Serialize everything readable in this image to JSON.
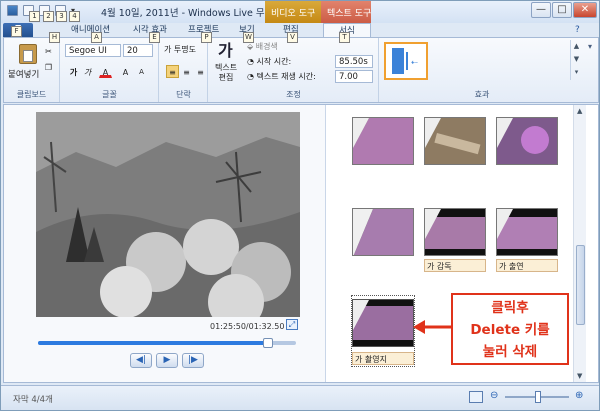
{
  "window": {
    "title": "4월 10일, 2011년 - Windows Live 무비 메이커",
    "context_tabs": [
      "비디오 도구",
      "텍스트 도구"
    ],
    "min_label": "—",
    "max_label": "□",
    "close_label": "✕"
  },
  "tabs": {
    "file": "≡",
    "labels": [
      "애니메이션",
      "시각 효과",
      "프로젝트",
      "보기",
      "편집",
      "서식"
    ],
    "keytips": [
      "1",
      "2",
      "3",
      "4",
      "F",
      "H",
      "A",
      "E",
      "P",
      "W",
      "V",
      "T"
    ]
  },
  "ribbon": {
    "clipboard": {
      "paste_label": "붙여넣기",
      "group_label": "클립보드"
    },
    "font": {
      "font_name": "Segoe UI",
      "font_size": "20",
      "group_label": "글꼴",
      "bold": "가",
      "italic": "가",
      "color": "A",
      "grow": "A",
      "shrink": "A"
    },
    "paragraph": {
      "transparency_label": "투명도",
      "group_label": "단락"
    },
    "adjust": {
      "text_edit_label": "텍스트\n편집",
      "bg_color_label": "배경색",
      "start_time_label": "시작 시간:",
      "start_time_value": "85.50s",
      "duration_label": "텍스트 재생 시간:",
      "duration_value": "7.00",
      "group_label": "조정"
    },
    "effects": {
      "group_label": "효과"
    }
  },
  "preview": {
    "time": "01:25:50/01:32.50",
    "seek_progress": 0.89
  },
  "storyboard": {
    "captions": [
      "가 감독",
      "가 출연",
      "가 촬영지"
    ]
  },
  "callout": {
    "line1": "클릭후",
    "line2": "Delete 키를",
    "line3": "눌러 삭제"
  },
  "status": {
    "text": "자막 4/4개"
  },
  "colors": {
    "accent": "#2d7be0",
    "callout": "#e0321a",
    "format_tab": "#cc5c46",
    "video_tab": "#c58914"
  }
}
